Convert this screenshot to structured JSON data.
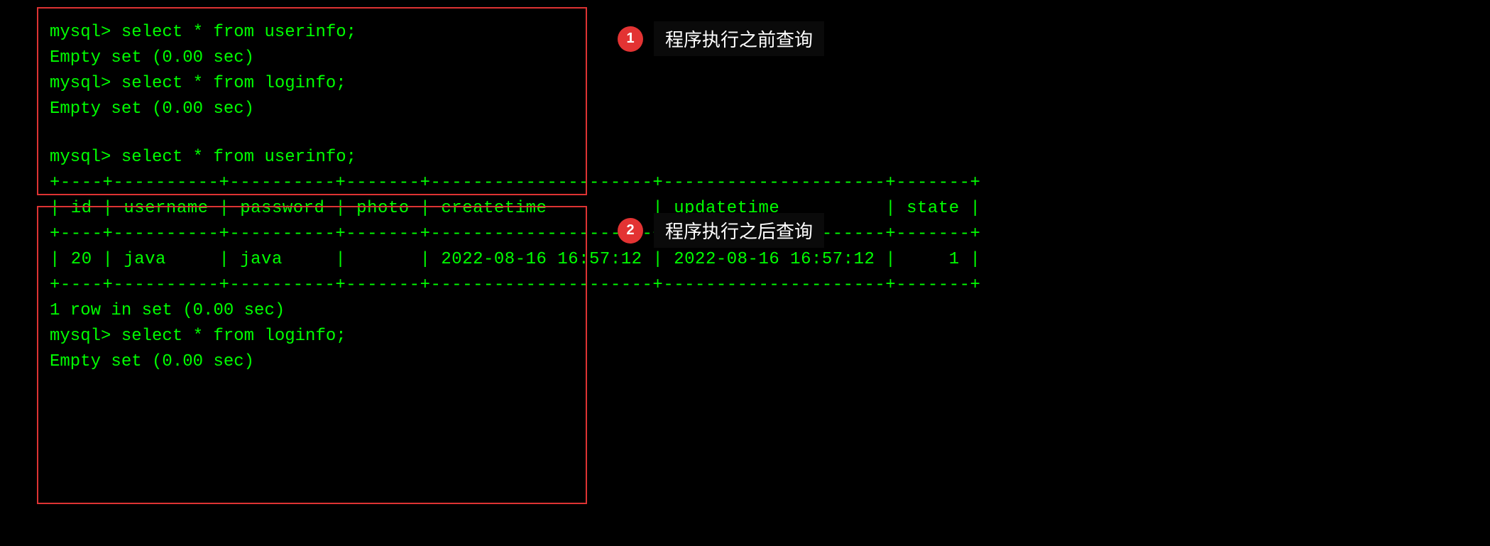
{
  "block1": {
    "line1": "mysql> select * from userinfo;",
    "line2": "Empty set (0.00 sec)",
    "line3": "",
    "line4": "mysql> select * from loginfo;",
    "line5": "Empty set (0.00 sec)"
  },
  "block2": {
    "line1": "mysql> select * from userinfo;",
    "sep": "+----+----------+----------+-------+---------------------+---------------------+-------+",
    "header": "| id | username | password | photo | createtime          | updatetime          | state |",
    "row1": "| 20 | java     | java     |       | 2022-08-16 16:57:12 | 2022-08-16 16:57:12 |     1 |",
    "line6": "1 row in set (0.00 sec)",
    "line7": "",
    "line8": "mysql> select * from loginfo;",
    "line9": "Empty set (0.00 sec)"
  },
  "annotations": {
    "badge1": "1",
    "label1": "程序执行之前查询",
    "badge2": "2",
    "label2": "程序执行之后查询"
  },
  "chart_data": {
    "type": "table",
    "table_name": "userinfo",
    "columns": [
      "id",
      "username",
      "password",
      "photo",
      "createtime",
      "updatetime",
      "state"
    ],
    "rows": [
      {
        "id": 20,
        "username": "java",
        "password": "java",
        "photo": "",
        "createtime": "2022-08-16 16:57:12",
        "updatetime": "2022-08-16 16:57:12",
        "state": 1
      }
    ],
    "row_count_message": "1 row in set (0.00 sec)",
    "empty_tables": [
      {
        "query": "select * from userinfo;",
        "result": "Empty set (0.00 sec)",
        "context": "before"
      },
      {
        "query": "select * from loginfo;",
        "result": "Empty set (0.00 sec)",
        "context": "before"
      },
      {
        "query": "select * from loginfo;",
        "result": "Empty set (0.00 sec)",
        "context": "after"
      }
    ]
  }
}
